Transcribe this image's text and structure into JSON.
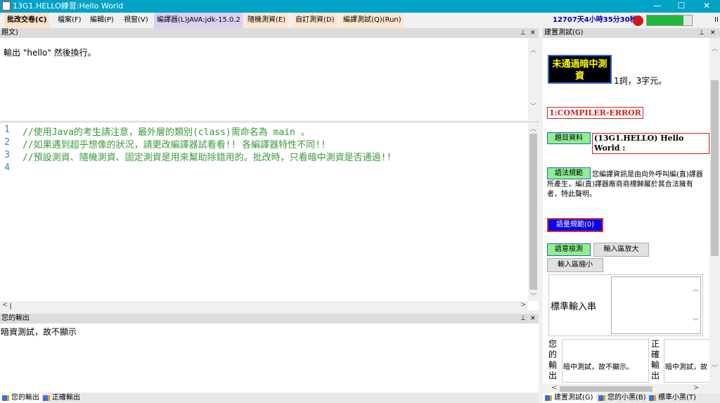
{
  "window": {
    "title": "13G1.HELLO練習:Hello World",
    "minimize": "—",
    "maximize": "☐",
    "close": "✕"
  },
  "menu": {
    "items": [
      "批改交卷(C)",
      "檔案(F)",
      "編輯(P)",
      "視窗(V)",
      "編譯器(L)JAVA:jdk-15.0.2",
      "隨機測資(E)",
      "自訂測資(D)",
      "編譯測試(Q)(Run)"
    ],
    "timer": "12707天4小時35分30秒",
    "progress": 0.81,
    "pause": "II"
  },
  "problem": {
    "header": "題文)",
    "text": "輸出 \"hello\" 然後換行。"
  },
  "editor": {
    "line_numbers": [
      "1",
      "2",
      "3",
      "4"
    ],
    "lines": [
      "//使用Java的考生請注意，最外層的類別(class)需命名為 main 。",
      "//如果遇到超乎想像的狀況，請更改編譯器試看看!! 各編譯器特性不同!!",
      "//預設測資、隨機測資、固定測資是用來幫助除錯用的。批改時，只看暗中測資是否通過!!",
      ""
    ]
  },
  "output": {
    "header": "您的輸出",
    "text": "暗資測試，故不顯示"
  },
  "bottom_tabs_left": [
    "您的輸出",
    "正確輸出"
  ],
  "side": {
    "header": "建置測試(G)",
    "status_badge": "未通過暗中測資",
    "word_count": "1詞，3字元。",
    "compiler_error": "1:COMPILER-ERROR",
    "problem_btn": "題目資料",
    "problem_info": "(13G1.HELLO) Hello World :",
    "syntax_btn": "語法規範",
    "syntax_text": "您編譯資訊是由向外呼叫編(直)譯器所產生，編(直)譯器廠商商標歸屬於其合法擁有者，特此聲明。",
    "semantic_btn": "語量規範(0)",
    "semantic_check_btn": "語意檢測",
    "input_enlarge": "輸入區放大",
    "input_shrink": "輸入區縮小",
    "std_input_label": "標準輸入串",
    "your_output_label": "您的輸出",
    "your_output_text": "暗中測試，故不顯示。",
    "correct_output_label": "正確輸出",
    "correct_output_text": "暗中測試，故"
  },
  "bottom_tabs_right": [
    "建置測試(G)",
    "您的小黑(B)",
    "標準小黑(T)"
  ],
  "colors": {
    "titlebar": "#00a2c6",
    "code_comment": "#3a9a3a",
    "timer": "#0000c0",
    "progress": "#1fb83b",
    "badge_bg": "#000000",
    "badge_fg": "#ffff00",
    "error": "#d42020"
  }
}
